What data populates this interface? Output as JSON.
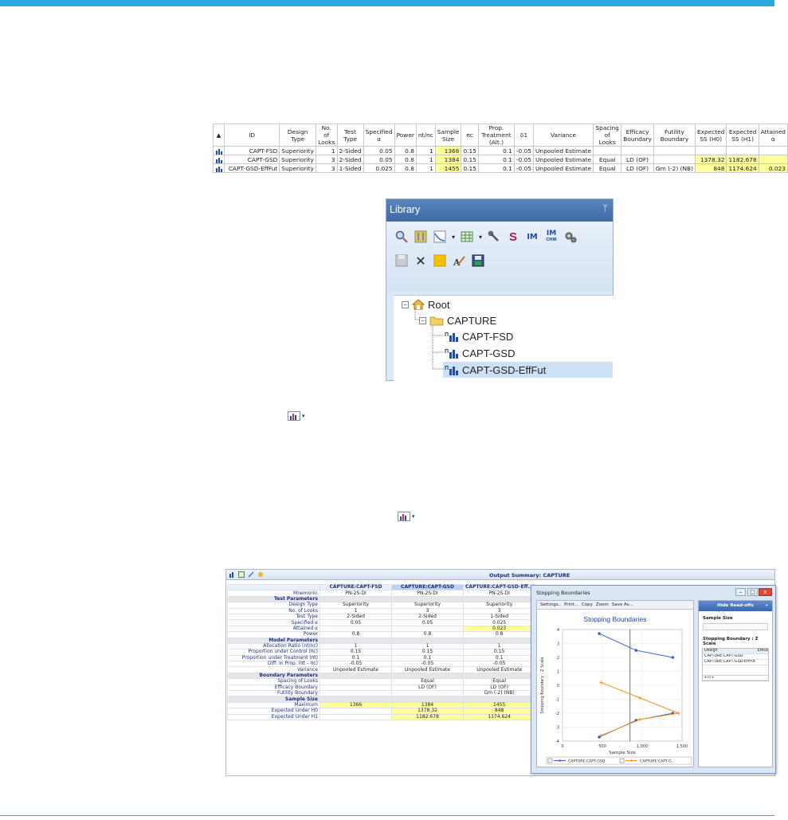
{
  "design_table": {
    "headers": [
      "ID",
      "Design Type",
      "No. of Looks",
      "Test Type",
      "Specified α",
      "Power",
      "nt/nc",
      "Sample Size",
      "πc",
      "Prop. Treatment (Alt.)",
      "δ1",
      "Variance",
      "Spacing of Looks",
      "Efficacy Boundary",
      "Futility Boundary",
      "Expected SS (H0)",
      "Expected SS (H1)",
      "Attained α"
    ],
    "rows": [
      [
        "CAPT-FSD",
        "Superiority",
        "1",
        "2-Sided",
        "0.05",
        "0.8",
        "1",
        "1366",
        "0.15",
        "0.1",
        "-0.05",
        "Unpooled Estimate",
        "",
        "",
        "",
        "",
        "",
        ""
      ],
      [
        "CAPT-GSD",
        "Superiority",
        "3",
        "2-Sided",
        "0.05",
        "0.8",
        "1",
        "1384",
        "0.15",
        "0.1",
        "-0.05",
        "Unpooled Estimate",
        "Equal",
        "LD (OF)",
        "",
        "1378.32",
        "1182.678",
        ""
      ],
      [
        "CAPT-GSD-EffFut",
        "Superiority",
        "3",
        "1-Sided",
        "0.025",
        "0.8",
        "1",
        "1455",
        "0.15",
        "0.1",
        "-0.05",
        "Unpooled Estimate",
        "Equal",
        "LD (OF)",
        "Gm (-2) (NB)",
        "848",
        "1174.624",
        "0.023"
      ]
    ]
  },
  "library": {
    "title": "Library",
    "pin": "ᛘ",
    "tree": {
      "root": "Root",
      "workbook": "CAPTURE",
      "designs": [
        "CAPT-FSD",
        "CAPT-GSD",
        "CAPT-GSD-EffFut"
      ]
    }
  },
  "output_summary": {
    "title": "Output Summary: CAPTURE",
    "columns": [
      "CAPTURE:CAPT-FSD",
      "CAPTURE:CAPT-GSD",
      "CAPTURE:CAPT-GSD-Eff..."
    ],
    "rows": [
      {
        "label": "Mnemonic",
        "values": [
          "PN-2S-DI",
          "PN-2S-DI",
          "PN-2S-DI"
        ]
      },
      {
        "section": "Test Parameters"
      },
      {
        "label": "Design Type",
        "values": [
          "Superiority",
          "Superiority",
          "Superiority"
        ]
      },
      {
        "label": "No. of Looks",
        "values": [
          "1",
          "3",
          "3"
        ]
      },
      {
        "label": "Test Type",
        "values": [
          "2-Sided",
          "2-Sided",
          "1-Sided"
        ]
      },
      {
        "label": "Specified α",
        "values": [
          "0.05",
          "0.05",
          "0.025"
        ]
      },
      {
        "label": "Attained α",
        "values": [
          "",
          "",
          "0.023"
        ]
      },
      {
        "label": "Power",
        "values": [
          "0.8",
          "0.8",
          "0.8"
        ]
      },
      {
        "section": "Model Parameters"
      },
      {
        "label": "Allocation Ratio (nt/nc)",
        "values": [
          "1",
          "1",
          "1"
        ]
      },
      {
        "label": "Proportion under Control (πc)",
        "values": [
          "0.15",
          "0.15",
          "0.15"
        ]
      },
      {
        "label": "Proportion under Treatment (πt)",
        "values": [
          "0.1",
          "0.1",
          "0.1"
        ]
      },
      {
        "label": "Diff. in Prop. (πt – πc)",
        "values": [
          "-0.05",
          "-0.05",
          "-0.05"
        ]
      },
      {
        "label": "Variance",
        "values": [
          "Unpooled Estimate",
          "Unpooled Estimate",
          "Unpooled Estimate"
        ]
      },
      {
        "section": "Boundary Parameters"
      },
      {
        "label": "Spacing of Looks",
        "values": [
          "",
          "Equal",
          "Equal"
        ]
      },
      {
        "label": "Efficacy Boundary",
        "values": [
          "",
          "LD (OF)",
          "LD (OF)"
        ]
      },
      {
        "label": "Futility Boundary",
        "values": [
          "",
          "",
          "Gm (-2) (NB)"
        ]
      },
      {
        "section": "Sample Size"
      },
      {
        "label": "Maximum",
        "values": [
          "1366",
          "1384",
          "1455"
        ]
      },
      {
        "label": "Expected Under H0",
        "values": [
          "",
          "1378.32",
          "848"
        ]
      },
      {
        "label": "Expected Under H1",
        "values": [
          "",
          "1182.678",
          "1174.624"
        ]
      }
    ]
  },
  "stopping_window": {
    "title": "Stopping Boundaries",
    "tabs": [
      "Settings..",
      "Print...",
      "Copy",
      "Zoom",
      "Save As..."
    ],
    "chart_title": "Stopping Boundaries",
    "hide_button": "Hide Read-offs",
    "hide_arrow": "»",
    "sample_size_label": "Sample Size",
    "boundary_label": "Stopping Boundary : Z Scale",
    "side_table_header": [
      "Design",
      "Effica"
    ],
    "side_table_rows": [
      "CAPTURE:CAPT-GSD",
      "CAPTURE:CAPT-GSD-EffFut"
    ],
    "scroll_text": "◂ III ▸",
    "window_buttons": [
      "–",
      "□",
      "x"
    ]
  },
  "chart_data": {
    "type": "line",
    "xlabel": "Sample Size",
    "ylabel": "Stopping Boundary : Z Scale",
    "xlim": [
      0,
      1500
    ],
    "ylim": [
      -4,
      4
    ],
    "x_ticks": [
      0,
      500,
      1000,
      1500
    ],
    "x_tick_labels": [
      "0",
      "500",
      "1,000",
      "1,500"
    ],
    "y_ticks": [
      -4,
      -3,
      -2,
      -1,
      0,
      1,
      2,
      3,
      4
    ],
    "vline_x": 848,
    "series": [
      {
        "name": "CAPTURE:CAPT-GSD",
        "color": "#3b62c4",
        "marker": "circle",
        "segments": [
          {
            "x": [
              461,
              923,
              1384
            ],
            "y": [
              3.71,
              2.51,
              2.0
            ]
          },
          {
            "x": [
              461,
              923,
              1384
            ],
            "y": [
              -3.71,
              -2.51,
              -2.0
            ]
          }
        ]
      },
      {
        "name": "CAPTURE:CAPT-GSD-EffFut",
        "color": "#f0931e",
        "marker": "plus",
        "segments": [
          {
            "x": [
              485,
              970,
              1455
            ],
            "y": [
              0.2,
              -0.9,
              -2.0
            ]
          },
          {
            "x": [
              485,
              970,
              1455
            ],
            "y": [
              -3.6,
              -2.45,
              -2.0
            ]
          }
        ]
      }
    ],
    "legend": [
      "CAPTURE:CAPT-GSD",
      "CAPTURE:CAPT-G..."
    ],
    "legend_position": "bottom"
  }
}
